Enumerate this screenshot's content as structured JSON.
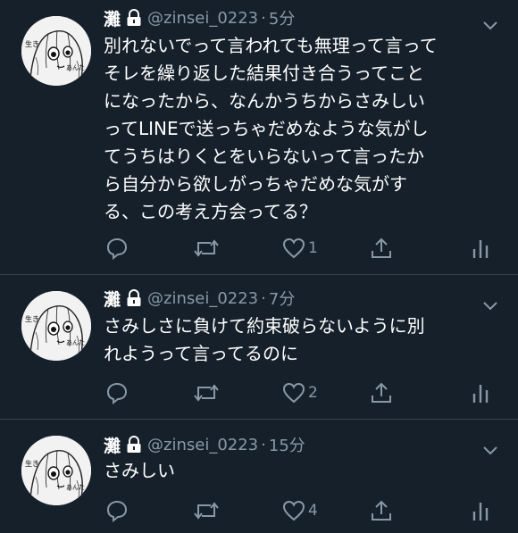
{
  "tweets": [
    {
      "name": "灘",
      "handle": "@zinsei_0223",
      "time": "5分",
      "text": "別れないでって言われても無理って言って\nそレを繰り返した結果付き合うってこと\nになったから、なんかうちからさみしい\nってLINEで送っちゃだめなような気がし\nてうちはりくとをいらないって言ったか\nら自分から欲しがっちゃだめな気がす\nる、この考え方会ってる？",
      "likes": "1"
    },
    {
      "name": "灘",
      "handle": "@zinsei_0223",
      "time": "7分",
      "text": "さみしさに負けて約束破らないように別\nれようって言ってるのに",
      "likes": "2"
    },
    {
      "name": "灘",
      "handle": "@zinsei_0223",
      "time": "15分",
      "text": "さみしい",
      "likes": "4"
    }
  ],
  "dot": "·",
  "avatar_labels": [
    "生き",
    "あんた"
  ],
  "colors": {
    "background": "#15202b",
    "text": "#ffffff",
    "muted": "#8899a6",
    "divider": "#38444d"
  }
}
